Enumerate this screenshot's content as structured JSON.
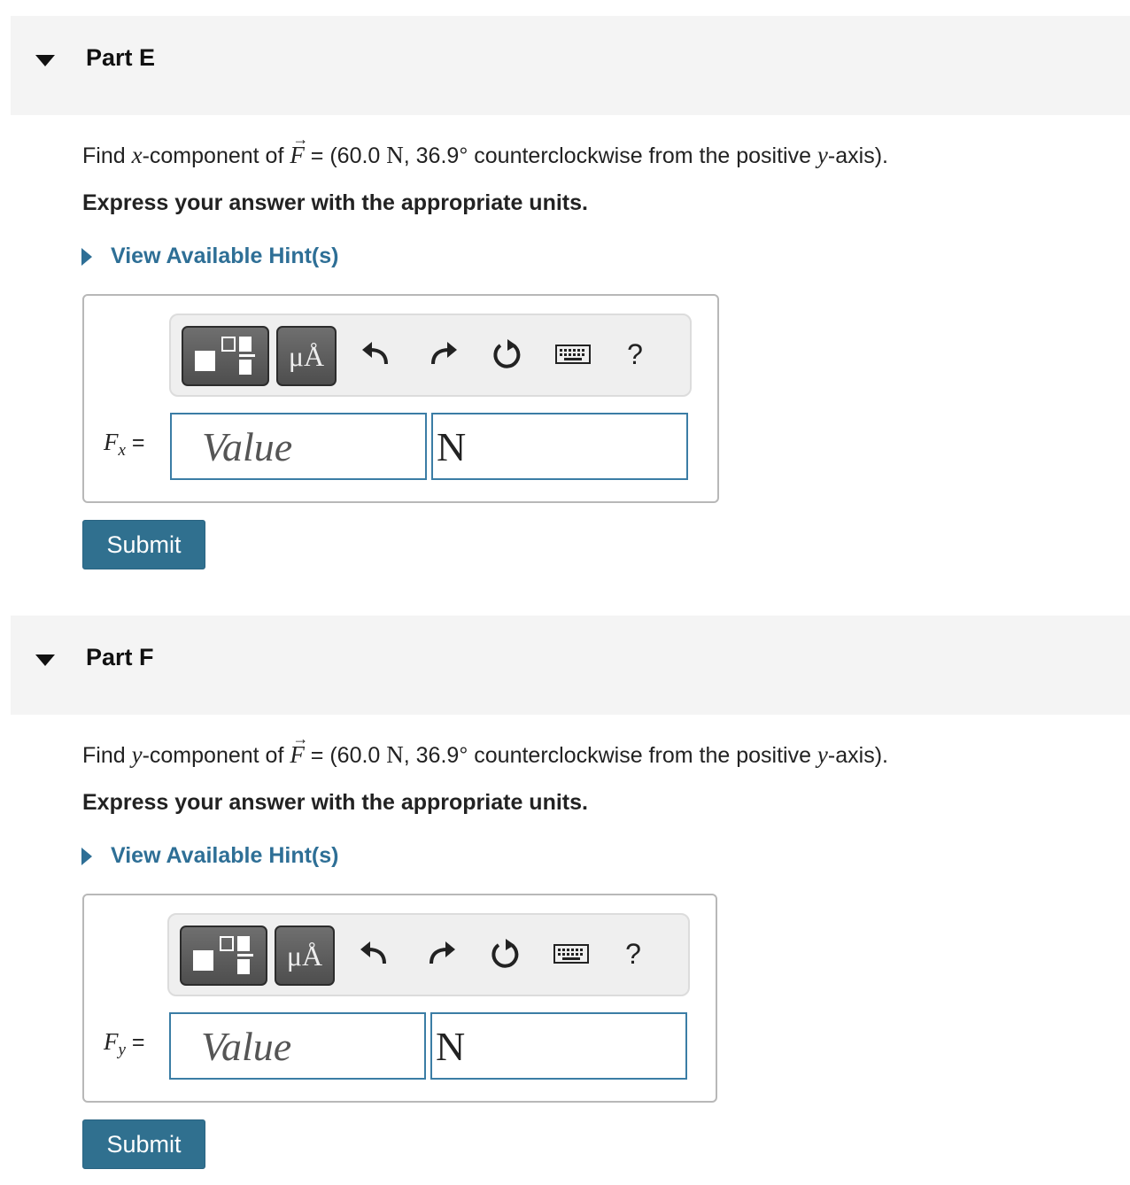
{
  "parts": [
    {
      "title": "Part E",
      "question": {
        "prefix": "Find ",
        "component_var": "x",
        "mid": "-component of ",
        "vector": "F",
        "eq_open": " = (60.0 ",
        "unit_n": "N",
        "angle": ", 36.9° counterclockwise from the positive ",
        "axis_var": "y",
        "suffix": "-axis)."
      },
      "instruction": "Express your answer with the appropriate units.",
      "hint_label": "View Available Hint(s)",
      "answer": {
        "label_main": "F",
        "label_sub": "x",
        "equals": " =",
        "value_placeholder": "Value",
        "unit_value": "N"
      },
      "toolbar": {
        "units_label": "μÅ",
        "help": "?"
      },
      "submit_label": "Submit"
    },
    {
      "title": "Part F",
      "question": {
        "prefix": "Find ",
        "component_var": "y",
        "mid": "-component of ",
        "vector": "F",
        "eq_open": " = (60.0 ",
        "unit_n": "N",
        "angle": ", 36.9° counterclockwise from the positive ",
        "axis_var": "y",
        "suffix": "-axis)."
      },
      "instruction": "Express your answer with the appropriate units.",
      "hint_label": "View Available Hint(s)",
      "answer": {
        "label_main": "F",
        "label_sub": "y",
        "equals": " =",
        "value_placeholder": "Value",
        "unit_value": "N"
      },
      "toolbar": {
        "units_label": "μÅ",
        "help": "?"
      },
      "submit_label": "Submit"
    }
  ],
  "icons": {
    "collapse": "caret-down-icon",
    "hint": "caret-right-icon",
    "templates": "templates-icon",
    "undo": "undo-icon",
    "redo": "redo-icon",
    "reset": "reset-icon",
    "keyboard": "keyboard-icon"
  },
  "colors": {
    "accent": "#30708f",
    "link": "#2e6f96",
    "input_border": "#3b7da5",
    "header_bg": "#f4f4f4"
  }
}
